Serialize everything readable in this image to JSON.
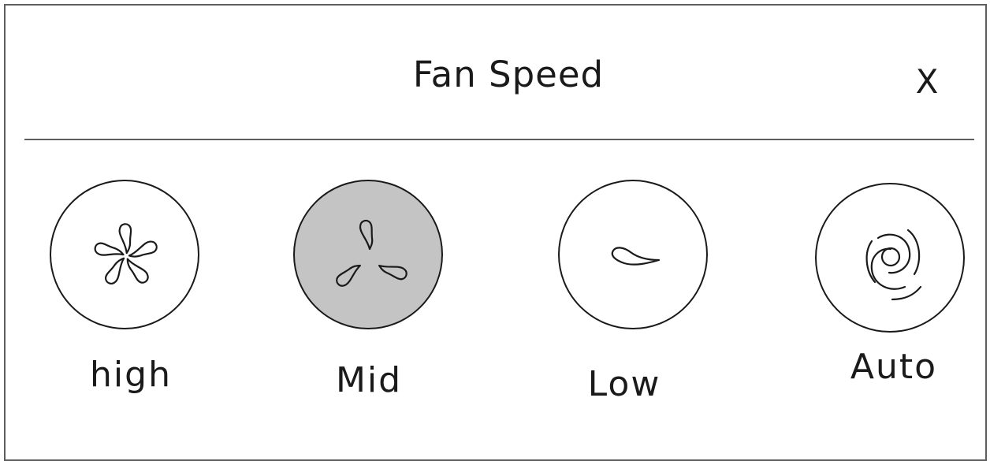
{
  "dialog": {
    "title": "Fan Speed",
    "close_label": "X"
  },
  "fan_speed": {
    "selected": "Mid",
    "options": [
      {
        "label": "high",
        "icon": "fan-high-icon"
      },
      {
        "label": "Mid",
        "icon": "fan-mid-icon"
      },
      {
        "label": "Low",
        "icon": "fan-low-icon"
      },
      {
        "label": "Auto",
        "icon": "fan-auto-icon"
      }
    ]
  },
  "colors": {
    "selected_fill": "#c4c4c4",
    "border": "#5e5e5e",
    "text": "#1a1a1a"
  }
}
